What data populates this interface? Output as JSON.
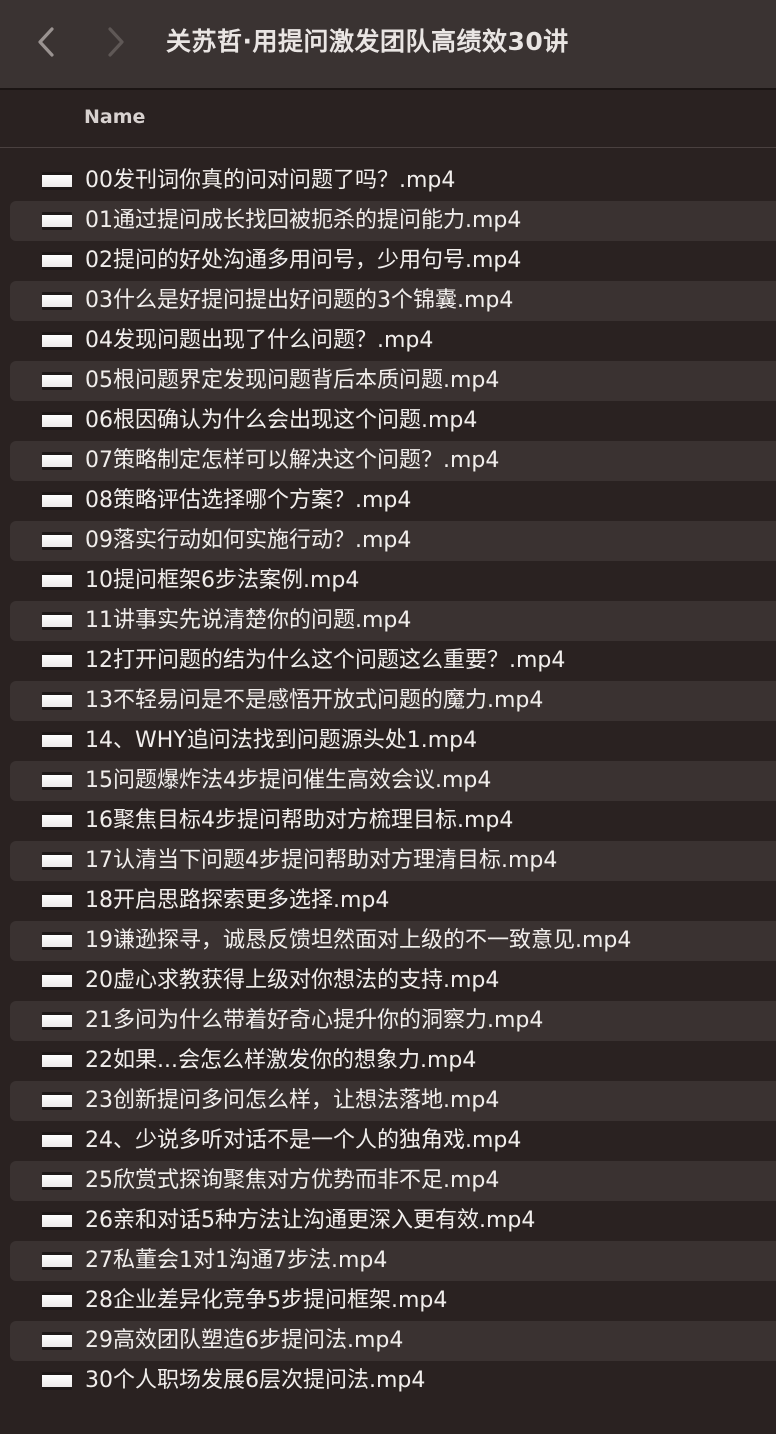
{
  "window": {
    "title": "关苏哲·用提问激发团队高绩效30讲"
  },
  "columns": {
    "name": "Name"
  },
  "files": [
    "00发刊词你真的问对问题了吗？.mp4",
    "01通过提问成长找回被扼杀的提问能力.mp4",
    "02提问的好处沟通多用问号，少用句号.mp4",
    "03什么是好提问提出好问题的3个锦囊.mp4",
    "04发现问题出现了什么问题？.mp4",
    "05根问题界定发现问题背后本质问题.mp4",
    "06根因确认为什么会出现这个问题.mp4",
    "07策略制定怎样可以解决这个问题？.mp4",
    "08策略评估选择哪个方案？.mp4",
    "09落实行动如何实施行动？.mp4",
    "10提问框架6步法案例.mp4",
    "11讲事实先说清楚你的问题.mp4",
    "12打开问题的结为什么这个问题这么重要？.mp4",
    "13不轻易问是不是感悟开放式问题的魔力.mp4",
    "14、WHY追问法找到问题源头处1.mp4",
    "15问题爆炸法4步提问催生高效会议.mp4",
    "16聚焦目标4步提问帮助对方梳理目标.mp4",
    "17认清当下问题4步提问帮助对方理清目标.mp4",
    "18开启思路探索更多选择.mp4",
    "19谦逊探寻，诚恳反馈坦然面对上级的不一致意见.mp4",
    "20虚心求教获得上级对你想法的支持.mp4",
    "21多问为什么带着好奇心提升你的洞察力.mp4",
    "22如果...会怎么样激发你的想象力.mp4",
    "23创新提问多问怎么样，让想法落地.mp4",
    "24、少说多听对话不是一个人的独角戏.mp4",
    "25欣赏式探询聚焦对方优势而非不足.mp4",
    "26亲和对话5种方法让沟通更深入更有效.mp4",
    "27私董会1对1沟通7步法.mp4",
    "28企业差异化竞争5步提问框架.mp4",
    "29高效团队塑造6步提问法.mp4",
    "30个人职场发展6层次提问法.mp4"
  ]
}
